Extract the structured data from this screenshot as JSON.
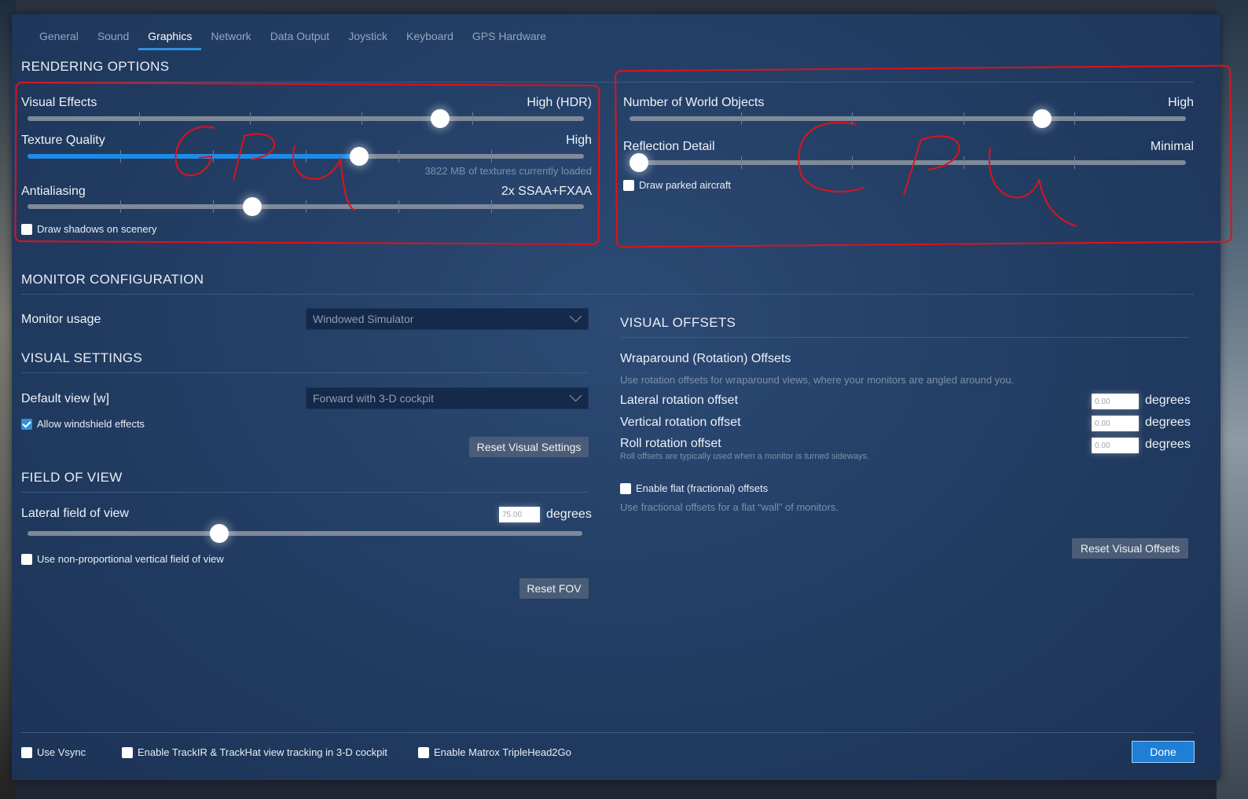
{
  "tabs": [
    "General",
    "Sound",
    "Graphics",
    "Network",
    "Data Output",
    "Joystick",
    "Keyboard",
    "GPS Hardware"
  ],
  "active_tab": "Graphics",
  "rendering": {
    "title": "RENDERING OPTIONS",
    "visual_effects": {
      "label": "Visual Effects",
      "value": "High (HDR)",
      "level": 0.75
    },
    "texture_quality": {
      "label": "Texture Quality",
      "value": "High",
      "level": 0.6,
      "note": "3822 MB of textures currently loaded"
    },
    "antialiasing": {
      "label": "Antialiasing",
      "value": "2x SSAA+FXAA",
      "level": 0.4
    },
    "draw_shadows": {
      "label": "Draw shadows on scenery",
      "checked": false
    },
    "world_objects": {
      "label": "Number of World Objects",
      "value": "High",
      "level": 0.75
    },
    "reflection_detail": {
      "label": "Reflection Detail",
      "value": "Minimal",
      "level": 0.0
    },
    "draw_parked": {
      "label": "Draw parked aircraft",
      "checked": false
    }
  },
  "annotations": {
    "left": "GPU",
    "right": "CPU",
    "color": "#e0121b"
  },
  "monitor": {
    "title": "MONITOR CONFIGURATION",
    "usage_label": "Monitor usage",
    "usage_value": "Windowed Simulator"
  },
  "visual_settings": {
    "title": "VISUAL SETTINGS",
    "default_view_label": "Default view [w]",
    "default_view_value": "Forward with 3-D cockpit",
    "windshield": {
      "label": "Allow windshield effects",
      "checked": true
    },
    "reset_label": "Reset Visual Settings"
  },
  "fov": {
    "title": "FIELD OF VIEW",
    "lateral_label": "Lateral field of view",
    "lateral_value": "75.00",
    "unit": "degrees",
    "level": 0.34,
    "non_prop": {
      "label": "Use non-proportional vertical field of view",
      "checked": false
    },
    "reset_label": "Reset FOV"
  },
  "offsets": {
    "title": "VISUAL OFFSETS",
    "wrap_title": "Wraparound (Rotation) Offsets",
    "wrap_hint": "Use rotation offsets for wraparound views, where your monitors are angled around you.",
    "lateral_label": "Lateral rotation offset",
    "vertical_label": "Vertical rotation offset",
    "roll_label": "Roll rotation offset",
    "roll_hint": "Roll offsets are typically used when a monitor is turned sideways.",
    "lateral_value": "0.00",
    "vertical_value": "0.00",
    "roll_value": "0.00",
    "unit": "degrees",
    "flat": {
      "label": "Enable flat (fractional) offsets",
      "checked": false
    },
    "flat_hint": "Use fractional offsets for a flat “wall” of monitors.",
    "reset_label": "Reset Visual Offsets"
  },
  "footer": {
    "vsync": {
      "label": "Use Vsync",
      "checked": false
    },
    "trackir": {
      "label": "Enable TrackIR & TrackHat view tracking in 3-D cockpit",
      "checked": false
    },
    "matrox": {
      "label": "Enable Matrox TripleHead2Go",
      "checked": false
    },
    "done_label": "Done"
  },
  "colors": {
    "accent": "#2f8fe0",
    "panel": "#223c62",
    "annotation": "#e0121b"
  }
}
